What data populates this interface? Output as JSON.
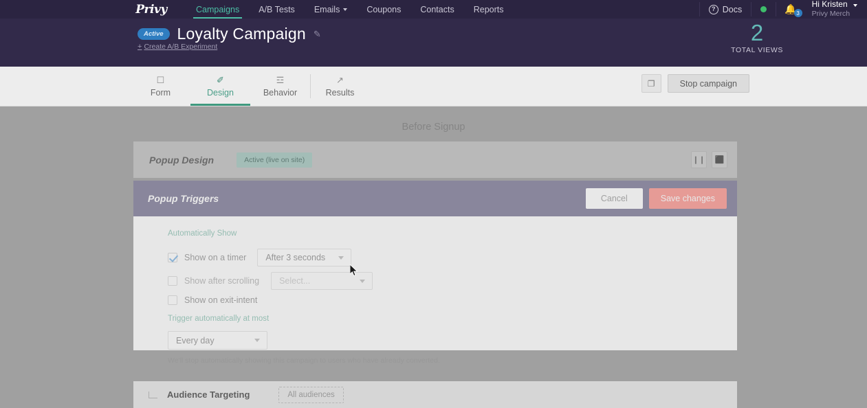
{
  "topnav": {
    "logo_text": "Privy",
    "items": [
      {
        "label": "Campaigns",
        "active": true,
        "caret": false
      },
      {
        "label": "A/B Tests",
        "active": false,
        "caret": false
      },
      {
        "label": "Emails",
        "active": false,
        "caret": true
      },
      {
        "label": "Coupons",
        "active": false,
        "caret": false
      },
      {
        "label": "Contacts",
        "active": false,
        "caret": false
      },
      {
        "label": "Reports",
        "active": false,
        "caret": false
      }
    ],
    "docs_label": "Docs",
    "notification_count": "3",
    "user_greeting": "Hi Kristen",
    "user_org": "Privy Merch"
  },
  "header": {
    "status_badge": "Active",
    "campaign_title": "Loyalty Campaign",
    "ab_experiment_link": "Create A/B Experiment",
    "ab_plus": "+",
    "stat_value": "2",
    "stat_label": "TOTAL VIEWS"
  },
  "tabs": {
    "items": [
      {
        "label": "Form",
        "icon": "☐",
        "active": false
      },
      {
        "label": "Design",
        "icon": "✐",
        "active": true
      },
      {
        "label": "Behavior",
        "icon": "☲",
        "active": false
      },
      {
        "label": "Results",
        "icon": "↗",
        "active": false
      }
    ],
    "duplicate_icon": "❐",
    "stop_campaign_label": "Stop campaign"
  },
  "content": {
    "section_heading": "Before Signup",
    "design_bar": {
      "title": "Popup Design",
      "status_badge": "Active (live on site)",
      "pause_icon": "❙❙",
      "delete_icon": "⬛"
    },
    "panel": {
      "title": "Popup Triggers",
      "cancel_label": "Cancel",
      "save_label": "Save changes",
      "automatically_show_label": "Automatically Show",
      "options": [
        {
          "label": "Show on a timer",
          "checked": true,
          "select_value": "After 3 seconds",
          "placeholder": false
        },
        {
          "label": "Show after scrolling",
          "checked": false,
          "select_value": "Select...",
          "placeholder": true
        },
        {
          "label": "Show on exit-intent",
          "checked": false,
          "select_value": null,
          "placeholder": false
        }
      ],
      "trigger_at_most_label": "Trigger automatically at most",
      "frequency_value": "Every day",
      "helper_text": "We'll stop automatically showing this campaign to users who have already converted."
    },
    "audience": {
      "title": "Audience Targeting",
      "pill_label": "All audiences"
    }
  },
  "colors": {
    "nav_bg": "#2b2441",
    "subheader_bg": "#322a4a",
    "accent_green": "#4cbfa6",
    "panel_header": "#3d3563",
    "save_red": "#f96057",
    "badge_blue": "#2f7dc0",
    "live_teal": "#a9cfc6"
  }
}
